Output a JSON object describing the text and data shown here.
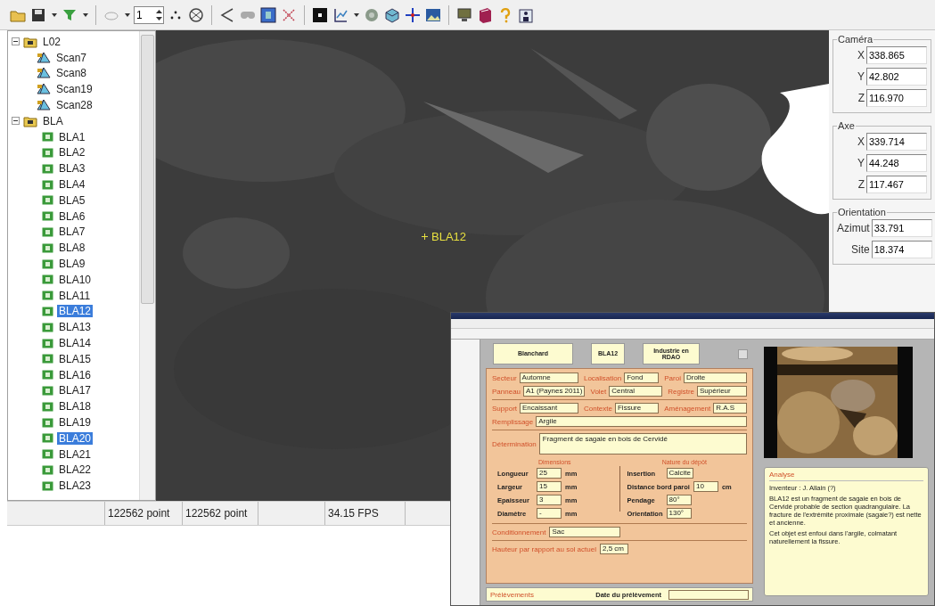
{
  "toolbar": {
    "spin_value": "1"
  },
  "tree": [
    {
      "label": "L02",
      "expanded": true,
      "children": [
        {
          "label": "Scan7",
          "kind": "scan",
          "selected": false
        },
        {
          "label": "Scan8",
          "kind": "scan",
          "selected": false
        },
        {
          "label": "Scan19",
          "kind": "scan",
          "selected": false
        },
        {
          "label": "Scan28",
          "kind": "scan",
          "selected": false
        }
      ]
    },
    {
      "label": "BLA",
      "expanded": true,
      "children": [
        {
          "label": "BLA1",
          "kind": "marker",
          "selected": false
        },
        {
          "label": "BLA2",
          "kind": "marker",
          "selected": false
        },
        {
          "label": "BLA3",
          "kind": "marker",
          "selected": false
        },
        {
          "label": "BLA4",
          "kind": "marker",
          "selected": false
        },
        {
          "label": "BLA5",
          "kind": "marker",
          "selected": false
        },
        {
          "label": "BLA6",
          "kind": "marker",
          "selected": false
        },
        {
          "label": "BLA7",
          "kind": "marker",
          "selected": false
        },
        {
          "label": "BLA8",
          "kind": "marker",
          "selected": false
        },
        {
          "label": "BLA9",
          "kind": "marker",
          "selected": false
        },
        {
          "label": "BLA10",
          "kind": "marker",
          "selected": false
        },
        {
          "label": "BLA11",
          "kind": "marker",
          "selected": false
        },
        {
          "label": "BLA12",
          "kind": "marker",
          "selected": true
        },
        {
          "label": "BLA13",
          "kind": "marker",
          "selected": false
        },
        {
          "label": "BLA14",
          "kind": "marker",
          "selected": false
        },
        {
          "label": "BLA15",
          "kind": "marker",
          "selected": false
        },
        {
          "label": "BLA16",
          "kind": "marker",
          "selected": false
        },
        {
          "label": "BLA17",
          "kind": "marker",
          "selected": false
        },
        {
          "label": "BLA18",
          "kind": "marker",
          "selected": false
        },
        {
          "label": "BLA19",
          "kind": "marker",
          "selected": false
        },
        {
          "label": "BLA20",
          "kind": "marker",
          "selected": true
        },
        {
          "label": "BLA21",
          "kind": "marker",
          "selected": false
        },
        {
          "label": "BLA22",
          "kind": "marker",
          "selected": false
        },
        {
          "label": "BLA23",
          "kind": "marker",
          "selected": false
        }
      ]
    }
  ],
  "viewport": {
    "marker_label": "BLA12"
  },
  "coordinates": [
    {
      "title": "Caméra",
      "fields": [
        {
          "label": "X",
          "value": "338.865"
        },
        {
          "label": "Y",
          "value": "42.802"
        },
        {
          "label": "Z",
          "value": "116.970"
        }
      ]
    },
    {
      "title": "Axe",
      "fields": [
        {
          "label": "X",
          "value": "339.714"
        },
        {
          "label": "Y",
          "value": "44.248"
        },
        {
          "label": "Z",
          "value": "117.467"
        }
      ]
    },
    {
      "title": "Orientation",
      "fields": [
        {
          "label": "Azimut",
          "value": "33.791"
        },
        {
          "label": "Site",
          "value": "18.374"
        }
      ]
    }
  ],
  "status_bar": {
    "points_1": "122562 point",
    "points_2": "122562 point",
    "fps": "34.15 FPS"
  },
  "record_window": {
    "header": [
      "Blanchard",
      "BLA12",
      "Industrie en RDAO"
    ],
    "location_rows": [
      [
        {
          "label": "Secteur",
          "value": "Automne"
        },
        {
          "label": "Localisation",
          "value": "Fond"
        },
        {
          "label": "Paroi",
          "value": "Droite"
        }
      ],
      [
        {
          "label": "Panneau",
          "value": "A1 (Paynes 2011)"
        },
        {
          "label": "Volet",
          "value": "Central"
        },
        {
          "label": "Registre",
          "value": "Supérieur"
        }
      ]
    ],
    "context_row": [
      {
        "label": "Support",
        "value": "Encaissant"
      },
      {
        "label": "Contexte",
        "value": "Fissure"
      },
      {
        "label": "Aménagement",
        "value": "R.A.S"
      }
    ],
    "filling": {
      "label": "Remplissage",
      "value": "Argile"
    },
    "determination": {
      "label": "Détermination",
      "value": "Fragment de sagaie en bois de Cervidé"
    },
    "dimensions": {
      "title": "Dimensions",
      "rows": [
        {
          "label": "Longueur",
          "value": "25",
          "unit": "mm"
        },
        {
          "label": "Largeur",
          "value": "15",
          "unit": "mm"
        },
        {
          "label": "Epaisseur",
          "value": "3",
          "unit": "mm"
        },
        {
          "label": "Diamètre",
          "value": "-",
          "unit": "mm"
        }
      ]
    },
    "deposit": {
      "title": "Nature du dépôt",
      "rows": [
        {
          "label": "Insertion",
          "value": "Calcite"
        },
        {
          "label": "Distance bord paroi",
          "value": "10",
          "unit": "cm"
        },
        {
          "label": "Pendage",
          "value": "80°"
        },
        {
          "label": "Orientation",
          "value": "130°"
        }
      ]
    },
    "packaging": {
      "label": "Conditionnement",
      "value": "Sac"
    },
    "height": {
      "label": "Hauteur par rapport au sol actuel",
      "value": "2,5 cm"
    },
    "samples": {
      "label": "Prélèvements",
      "date_label": "Date du prélèvement"
    },
    "analysis": {
      "title": "Analyse",
      "inventor": "Inventeur : J. Allain (?)",
      "paragraphs": [
        "BLA12 est un fragment de sagaie en bois de Cervidé probable de section quadrangulaire. La fracture de l'extrémité proximale (sagaie?) est nette et ancienne.",
        "Cet objet est enfoui dans l'argile, colmatant naturellement la fissure."
      ]
    }
  }
}
